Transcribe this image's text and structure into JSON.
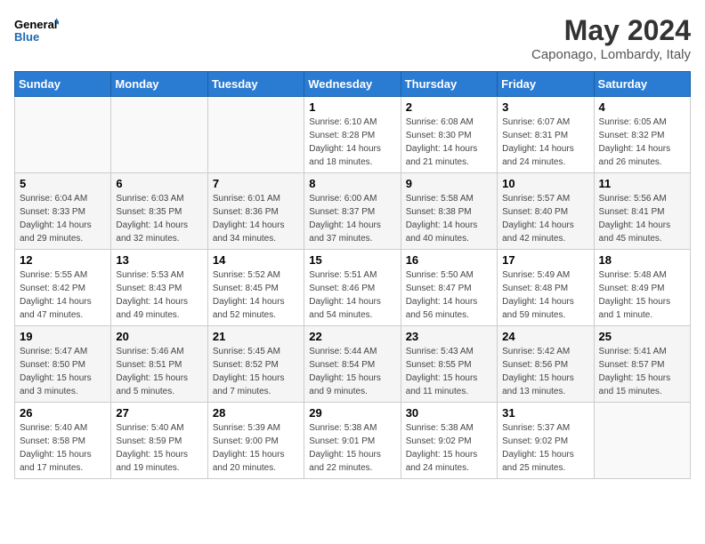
{
  "header": {
    "logo_line1": "General",
    "logo_line2": "Blue",
    "month": "May 2024",
    "location": "Caponago, Lombardy, Italy"
  },
  "weekdays": [
    "Sunday",
    "Monday",
    "Tuesday",
    "Wednesday",
    "Thursday",
    "Friday",
    "Saturday"
  ],
  "weeks": [
    [
      {
        "day": "",
        "info": ""
      },
      {
        "day": "",
        "info": ""
      },
      {
        "day": "",
        "info": ""
      },
      {
        "day": "1",
        "info": "Sunrise: 6:10 AM\nSunset: 8:28 PM\nDaylight: 14 hours and 18 minutes."
      },
      {
        "day": "2",
        "info": "Sunrise: 6:08 AM\nSunset: 8:30 PM\nDaylight: 14 hours and 21 minutes."
      },
      {
        "day": "3",
        "info": "Sunrise: 6:07 AM\nSunset: 8:31 PM\nDaylight: 14 hours and 24 minutes."
      },
      {
        "day": "4",
        "info": "Sunrise: 6:05 AM\nSunset: 8:32 PM\nDaylight: 14 hours and 26 minutes."
      }
    ],
    [
      {
        "day": "5",
        "info": "Sunrise: 6:04 AM\nSunset: 8:33 PM\nDaylight: 14 hours and 29 minutes."
      },
      {
        "day": "6",
        "info": "Sunrise: 6:03 AM\nSunset: 8:35 PM\nDaylight: 14 hours and 32 minutes."
      },
      {
        "day": "7",
        "info": "Sunrise: 6:01 AM\nSunset: 8:36 PM\nDaylight: 14 hours and 34 minutes."
      },
      {
        "day": "8",
        "info": "Sunrise: 6:00 AM\nSunset: 8:37 PM\nDaylight: 14 hours and 37 minutes."
      },
      {
        "day": "9",
        "info": "Sunrise: 5:58 AM\nSunset: 8:38 PM\nDaylight: 14 hours and 40 minutes."
      },
      {
        "day": "10",
        "info": "Sunrise: 5:57 AM\nSunset: 8:40 PM\nDaylight: 14 hours and 42 minutes."
      },
      {
        "day": "11",
        "info": "Sunrise: 5:56 AM\nSunset: 8:41 PM\nDaylight: 14 hours and 45 minutes."
      }
    ],
    [
      {
        "day": "12",
        "info": "Sunrise: 5:55 AM\nSunset: 8:42 PM\nDaylight: 14 hours and 47 minutes."
      },
      {
        "day": "13",
        "info": "Sunrise: 5:53 AM\nSunset: 8:43 PM\nDaylight: 14 hours and 49 minutes."
      },
      {
        "day": "14",
        "info": "Sunrise: 5:52 AM\nSunset: 8:45 PM\nDaylight: 14 hours and 52 minutes."
      },
      {
        "day": "15",
        "info": "Sunrise: 5:51 AM\nSunset: 8:46 PM\nDaylight: 14 hours and 54 minutes."
      },
      {
        "day": "16",
        "info": "Sunrise: 5:50 AM\nSunset: 8:47 PM\nDaylight: 14 hours and 56 minutes."
      },
      {
        "day": "17",
        "info": "Sunrise: 5:49 AM\nSunset: 8:48 PM\nDaylight: 14 hours and 59 minutes."
      },
      {
        "day": "18",
        "info": "Sunrise: 5:48 AM\nSunset: 8:49 PM\nDaylight: 15 hours and 1 minute."
      }
    ],
    [
      {
        "day": "19",
        "info": "Sunrise: 5:47 AM\nSunset: 8:50 PM\nDaylight: 15 hours and 3 minutes."
      },
      {
        "day": "20",
        "info": "Sunrise: 5:46 AM\nSunset: 8:51 PM\nDaylight: 15 hours and 5 minutes."
      },
      {
        "day": "21",
        "info": "Sunrise: 5:45 AM\nSunset: 8:52 PM\nDaylight: 15 hours and 7 minutes."
      },
      {
        "day": "22",
        "info": "Sunrise: 5:44 AM\nSunset: 8:54 PM\nDaylight: 15 hours and 9 minutes."
      },
      {
        "day": "23",
        "info": "Sunrise: 5:43 AM\nSunset: 8:55 PM\nDaylight: 15 hours and 11 minutes."
      },
      {
        "day": "24",
        "info": "Sunrise: 5:42 AM\nSunset: 8:56 PM\nDaylight: 15 hours and 13 minutes."
      },
      {
        "day": "25",
        "info": "Sunrise: 5:41 AM\nSunset: 8:57 PM\nDaylight: 15 hours and 15 minutes."
      }
    ],
    [
      {
        "day": "26",
        "info": "Sunrise: 5:40 AM\nSunset: 8:58 PM\nDaylight: 15 hours and 17 minutes."
      },
      {
        "day": "27",
        "info": "Sunrise: 5:40 AM\nSunset: 8:59 PM\nDaylight: 15 hours and 19 minutes."
      },
      {
        "day": "28",
        "info": "Sunrise: 5:39 AM\nSunset: 9:00 PM\nDaylight: 15 hours and 20 minutes."
      },
      {
        "day": "29",
        "info": "Sunrise: 5:38 AM\nSunset: 9:01 PM\nDaylight: 15 hours and 22 minutes."
      },
      {
        "day": "30",
        "info": "Sunrise: 5:38 AM\nSunset: 9:02 PM\nDaylight: 15 hours and 24 minutes."
      },
      {
        "day": "31",
        "info": "Sunrise: 5:37 AM\nSunset: 9:02 PM\nDaylight: 15 hours and 25 minutes."
      },
      {
        "day": "",
        "info": ""
      }
    ]
  ]
}
